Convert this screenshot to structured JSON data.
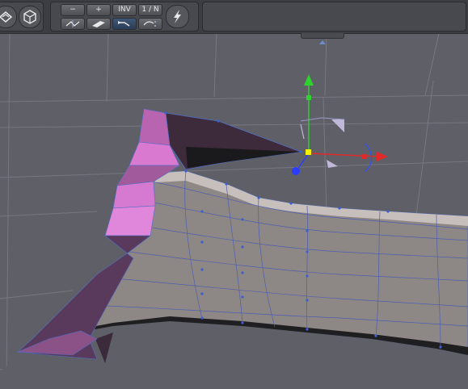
{
  "toolbar": {
    "left_tools": [
      {
        "name": "view-icon"
      },
      {
        "name": "cube-icon"
      }
    ],
    "minus_label": "−",
    "plus_label": "+",
    "inv_label": "INV",
    "ratio_label": "1 / N",
    "mode_buttons": [
      {
        "name": "symmetry-icon",
        "selected": false
      },
      {
        "name": "edge-icon",
        "selected": false
      },
      {
        "name": "pointer-icon",
        "selected": true
      },
      {
        "name": "split-icon",
        "selected": false
      }
    ],
    "lightning_icon": "lightning-icon"
  },
  "viewport": {
    "background": "#5e5f66",
    "mesh_surface": "#8c8684",
    "selection_color": "#d26dc9",
    "gizmo": {
      "x_axis_color": "#e02a2a",
      "y_axis_color": "#2ed12e",
      "z_axis_color": "#2a3cff"
    }
  }
}
